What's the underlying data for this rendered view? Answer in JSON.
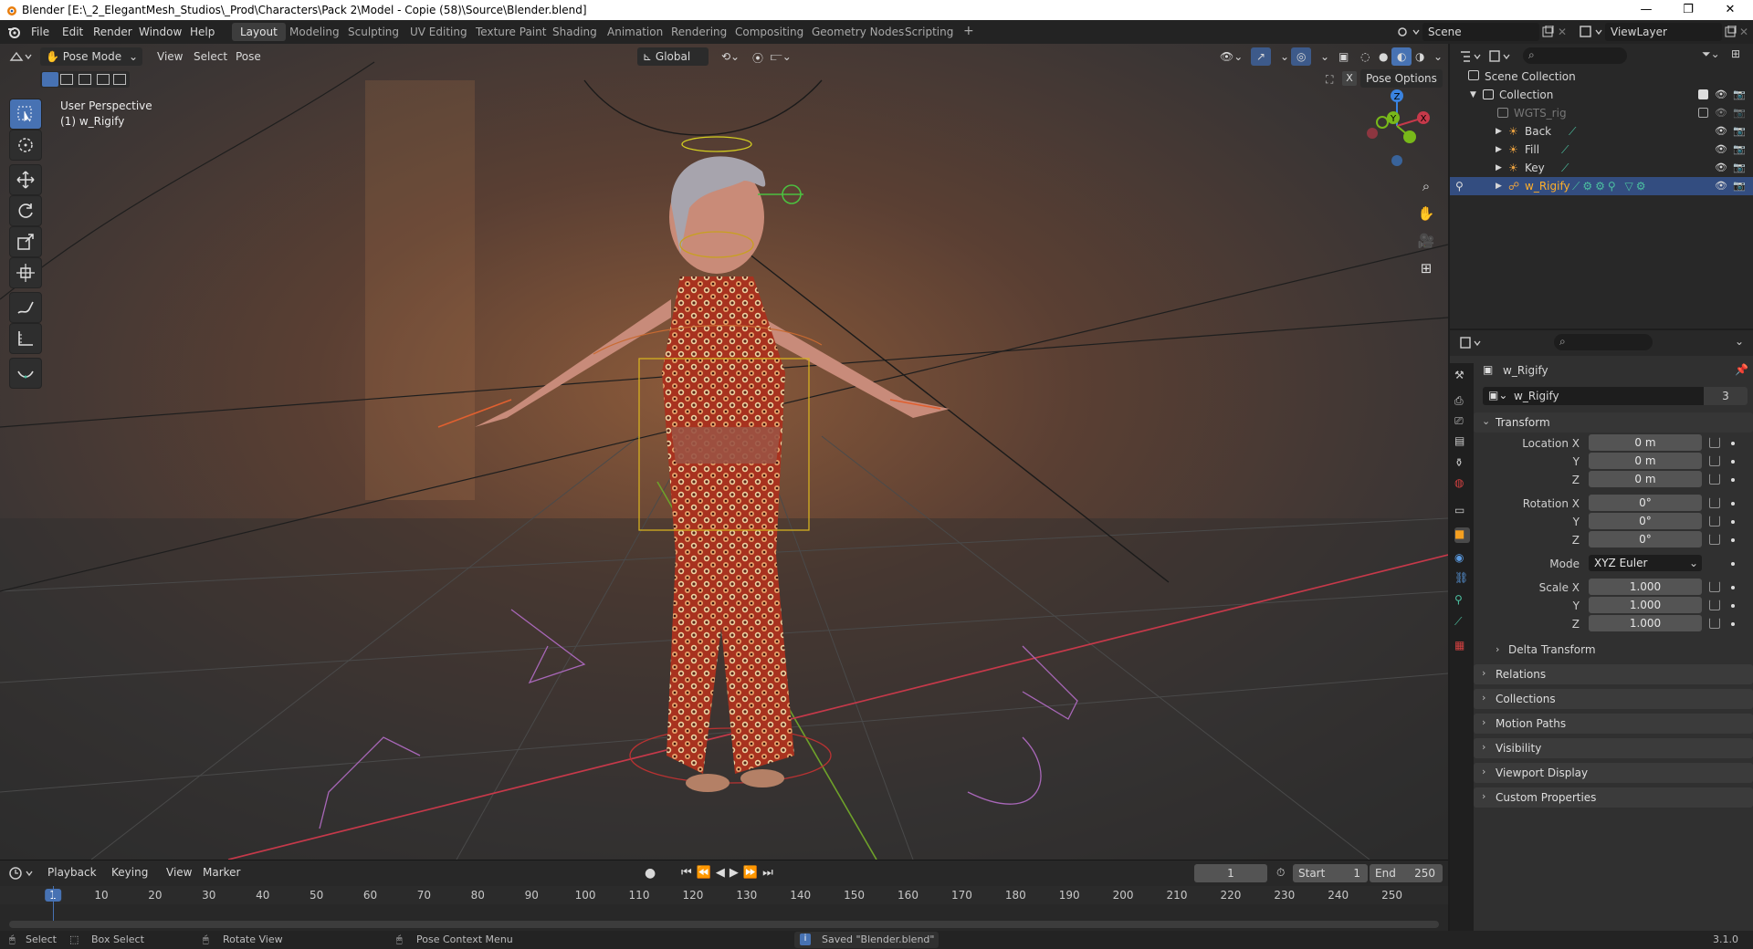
{
  "window": {
    "title": "Blender [E:\\_2_ElegantMesh_Studios\\_Prod\\Characters\\Pack 2\\Model - Copie (58)\\Source\\Blender.blend]",
    "minimize": "—",
    "maximize": "❐",
    "close": "✕"
  },
  "menubar": {
    "items": [
      "File",
      "Edit",
      "Render",
      "Window",
      "Help"
    ],
    "workspaces": [
      "Layout",
      "Modeling",
      "Sculpting",
      "UV Editing",
      "Texture Paint",
      "Shading",
      "Animation",
      "Rendering",
      "Compositing",
      "Geometry Nodes",
      "Scripting"
    ],
    "active_workspace": "Layout",
    "add_workspace": "+",
    "scene": "Scene",
    "view_layer": "ViewLayer"
  },
  "viewport": {
    "mode": "Pose Mode",
    "menus": [
      "View",
      "Select",
      "Pose"
    ],
    "orientation": "Global",
    "pose_options": "Pose Options",
    "overlay_line1": "User Perspective",
    "overlay_line2": "(1) w_Rigify",
    "gizmo": {
      "x": "X",
      "y": "Y",
      "z": "Z"
    }
  },
  "timeline": {
    "menus": [
      "Playback",
      "Keying",
      "View",
      "Marker"
    ],
    "current_frame": "1",
    "start_label": "Start",
    "start_value": "1",
    "end_label": "End",
    "end_value": "250",
    "ruler": [
      "1",
      "10",
      "20",
      "30",
      "40",
      "50",
      "60",
      "70",
      "80",
      "90",
      "100",
      "110",
      "120",
      "130",
      "140",
      "150",
      "160",
      "170",
      "180",
      "190",
      "200",
      "210",
      "220",
      "230",
      "240",
      "250"
    ]
  },
  "outliner": {
    "root": "Scene Collection",
    "collection": "Collection",
    "items": [
      {
        "label": "WGTS_rig",
        "dim": true
      },
      {
        "label": "Back",
        "dim": false
      },
      {
        "label": "Fill",
        "dim": false
      },
      {
        "label": "Key",
        "dim": false
      },
      {
        "label": "w_Rigify",
        "dim": false,
        "selected": true
      }
    ]
  },
  "properties": {
    "object_name": "w_Rigify",
    "data_name": "w_Rigify",
    "users": "3",
    "transform_header": "Transform",
    "location_label": "Location X",
    "rotation_label": "Rotation X",
    "scale_label": "Scale X",
    "y_label": "Y",
    "z_label": "Z",
    "location": [
      "0 m",
      "0 m",
      "0 m"
    ],
    "rotation": [
      "0°",
      "0°",
      "0°"
    ],
    "mode_label": "Mode",
    "mode_value": "XYZ Euler",
    "scale": [
      "1.000",
      "1.000",
      "1.000"
    ],
    "delta": "Delta Transform",
    "panels": [
      "Relations",
      "Collections",
      "Motion Paths",
      "Visibility",
      "Viewport Display",
      "Custom Properties"
    ]
  },
  "statusbar": {
    "select": "Select",
    "box_select": "Box Select",
    "rotate_view": "Rotate View",
    "context_menu": "Pose Context Menu",
    "message": "Saved \"Blender.blend\"",
    "version": "3.1.0"
  },
  "colors": {
    "accent": "#4772b3",
    "selection": "#334d80",
    "x_axis": "#d03a4c",
    "y_axis": "#78b81a",
    "z_axis": "#3a83e0"
  }
}
